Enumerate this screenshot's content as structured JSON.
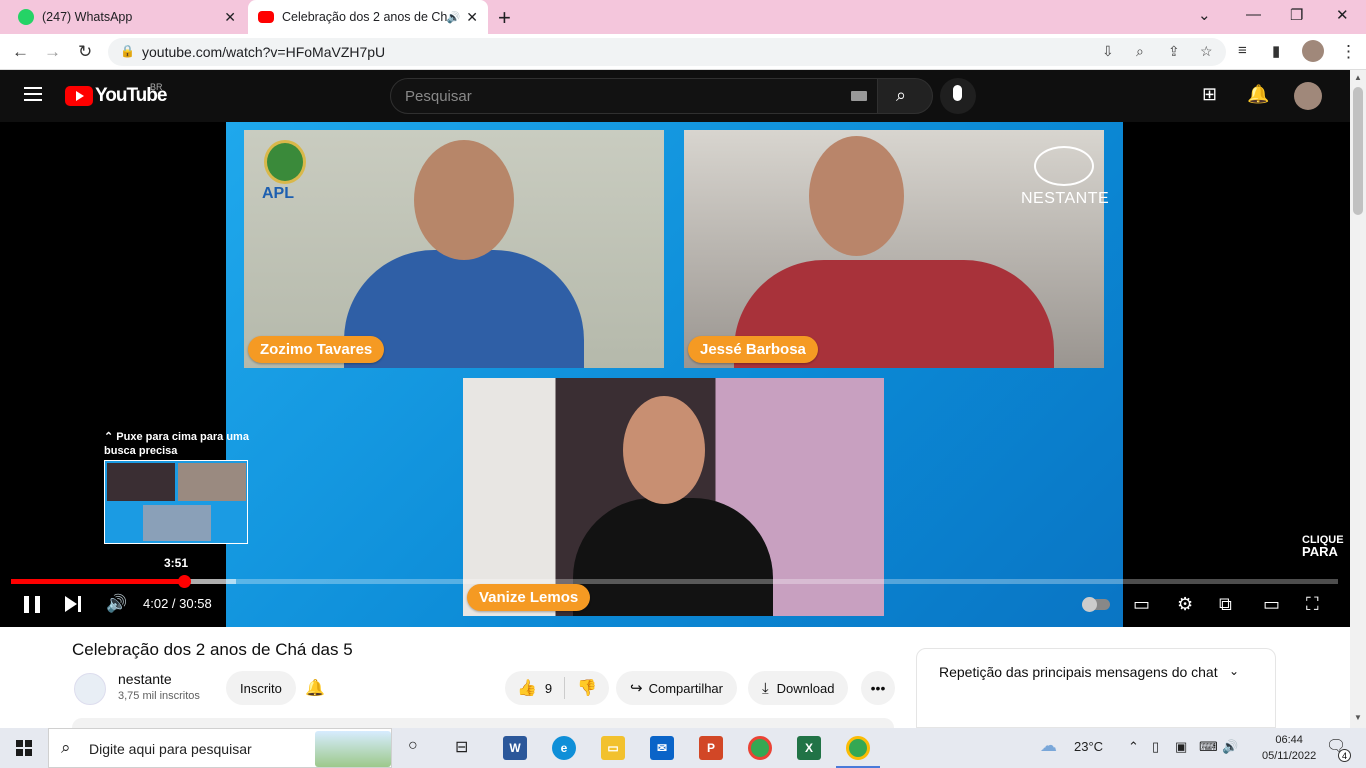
{
  "browser": {
    "tabs": [
      {
        "title": "(247) WhatsApp",
        "active": false
      },
      {
        "title": "Celebração dos 2 anos de Chá",
        "active": true
      }
    ],
    "url": "youtube.com/watch?v=HFoMaVZH7pU"
  },
  "youtube": {
    "logo_text": "YouTube",
    "region": "BR",
    "search_placeholder": "Pesquisar"
  },
  "video": {
    "participants": [
      "Zozimo Tavares",
      "Jessé Barbosa",
      "Vanize Lemos"
    ],
    "apl_label": "APL",
    "brand_label": "NESTANTE",
    "subscribe_overlay": [
      "CLIQUE",
      "PARA"
    ],
    "seek_hint": "⌃ Puxe para cima para uma busca precisa",
    "preview_time": "3:51",
    "current_time": "4:02",
    "duration": "30:58",
    "time_display": "4:02 / 30:58",
    "progress_fraction": 0.13
  },
  "details": {
    "title": "Celebração dos 2 anos de Chá das 5",
    "channel": "nestante",
    "subscribers": "3,75 mil inscritos",
    "subscribed_label": "Inscrito",
    "likes": "9",
    "share_label": "Compartilhar",
    "download_label": "Download",
    "chat_title": "Repetição das principais mensagens do chat"
  },
  "taskbar": {
    "search_placeholder": "Digite aqui para pesquisar",
    "weather": "23°C",
    "time": "06:44",
    "date": "05/11/2022",
    "notifications": "4"
  },
  "colors": {
    "youtube_red": "#ff0000",
    "tabstrip_pink": "#f4c6dc",
    "name_tag_orange": "#f59a23",
    "stage_blue": "#1fa8ec"
  }
}
